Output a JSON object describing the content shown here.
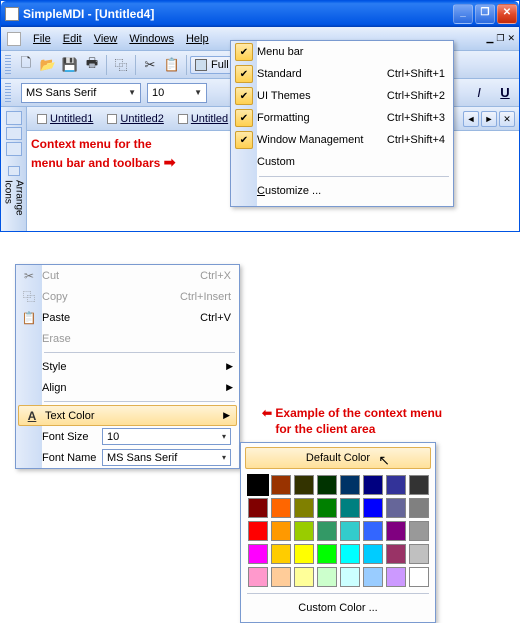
{
  "titlebar": {
    "title": "SimpleMDI - [Untitled4]"
  },
  "menubar": {
    "file": "File",
    "edit": "Edit",
    "view": "View",
    "windows": "Windows",
    "help": "Help"
  },
  "toolbar1": {
    "full_label": "Full S"
  },
  "toolbar2": {
    "font_name": "MS Sans Serif",
    "font_size": "10"
  },
  "tabs": {
    "t1": "Untitled1",
    "t2": "Untitled2",
    "t3": "Untitled"
  },
  "vtab": {
    "arrange": "Arrange Icons"
  },
  "annotation1_l1": "Context menu for the",
  "annotation1_l2": "menu bar and toolbars",
  "annotation1_arrow": "➡",
  "ctx1": {
    "menubar": "Menu bar",
    "standard": "Standard",
    "sc_standard": "Ctrl+Shift+1",
    "uithemes": "UI Themes",
    "sc_uithemes": "Ctrl+Shift+2",
    "formatting": "Formatting",
    "sc_formatting": "Ctrl+Shift+3",
    "winmgmt": "Window Management",
    "sc_winmgmt": "Ctrl+Shift+4",
    "custom": "Custom",
    "customize": "Customize ..."
  },
  "ctx2": {
    "cut": "Cut",
    "sc_cut": "Ctrl+X",
    "copy": "Copy",
    "sc_copy": "Ctrl+Insert",
    "paste": "Paste",
    "sc_paste": "Ctrl+V",
    "erase": "Erase",
    "style": "Style",
    "align": "Align",
    "textcolor": "Text Color",
    "fontsize_lbl": "Font Size",
    "fontsize_val": "10",
    "fontname_lbl": "Font Name",
    "fontname_val": "MS Sans Serif"
  },
  "annotation2_arrow": "⬅",
  "annotation2_l1": "Example of the context menu",
  "annotation2_l2": "for the client area",
  "colorpicker": {
    "default": "Default Color",
    "custom": "Custom Color ...",
    "colors": [
      "#000000",
      "#993300",
      "#333300",
      "#003300",
      "#003366",
      "#000080",
      "#333399",
      "#333333",
      "#800000",
      "#ff6600",
      "#808000",
      "#008000",
      "#008080",
      "#0000ff",
      "#666699",
      "#808080",
      "#ff0000",
      "#ff9900",
      "#99cc00",
      "#339966",
      "#33cccc",
      "#3366ff",
      "#800080",
      "#999999",
      "#ff00ff",
      "#ffcc00",
      "#ffff00",
      "#00ff00",
      "#00ffff",
      "#00ccff",
      "#993366",
      "#c0c0c0",
      "#ff99cc",
      "#ffcc99",
      "#ffff99",
      "#ccffcc",
      "#ccffff",
      "#99ccff",
      "#cc99ff",
      "#ffffff"
    ]
  }
}
